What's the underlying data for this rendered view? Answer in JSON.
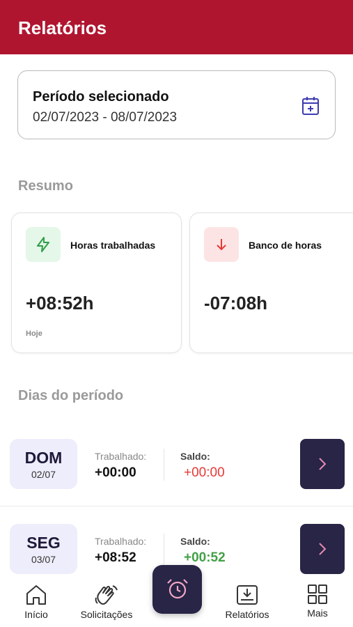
{
  "header": {
    "title": "Relatórios"
  },
  "period": {
    "title": "Período selecionado",
    "range": "02/07/2023 - 08/07/2023",
    "icon": "calendar-add-icon"
  },
  "summary": {
    "label": "Resumo",
    "cards": [
      {
        "title": "Horas trabalhadas",
        "value": "+08:52h",
        "sub": "Hoje",
        "icon": "lightning-icon"
      },
      {
        "title": "Banco de horas",
        "value": "-07:08h",
        "sub": "",
        "icon": "arrow-down-icon"
      }
    ]
  },
  "days": {
    "label": "Dias do período",
    "worked_label": "Trabalhado:",
    "balance_label": "Saldo:",
    "rows": [
      {
        "day": "DOM",
        "date": "02/07",
        "worked": "+00:00",
        "balance": "+00:00",
        "balance_color": "#e53935"
      },
      {
        "day": "SEG",
        "date": "03/07",
        "worked": "+08:52",
        "balance": "+00:52",
        "balance_color": "#43a047"
      }
    ]
  },
  "nav": {
    "items": [
      {
        "label": "Início",
        "icon": "home-icon"
      },
      {
        "label": "Solicitações",
        "icon": "hand-wave-icon"
      },
      {
        "label": "Relatórios",
        "icon": "download-tray-icon"
      },
      {
        "label": "Mais",
        "icon": "grid-icon"
      }
    ],
    "fab_icon": "alarm-clock-icon"
  },
  "colors": {
    "brand": "#b01530",
    "dark": "#282546",
    "badge_bg": "#eeedfb",
    "negative": "#e53935",
    "positive": "#43a047"
  }
}
